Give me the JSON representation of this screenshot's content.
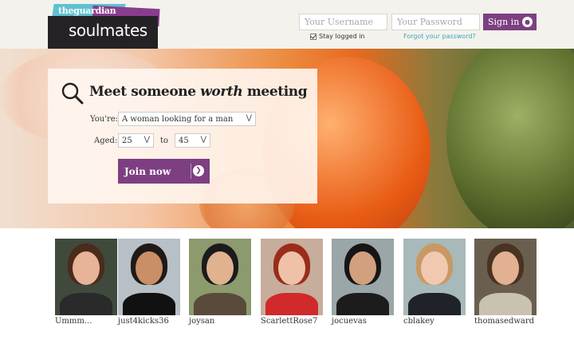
{
  "header": {
    "logo_small": "theguardian",
    "logo_big": "soulmates",
    "username_placeholder": "Your Username",
    "password_placeholder": "Your Password",
    "signin_label": "Sign in",
    "stay_logged_in": "Stay logged in",
    "forgot_password": "Forgot your password?"
  },
  "hero": {
    "title_pre": "Meet someone ",
    "title_em": "worth",
    "title_post": " meeting",
    "youre_label": "You're:",
    "youre_value": "A woman looking for a man",
    "aged_label": "Aged:",
    "age_min": "25",
    "age_to": "to",
    "age_max": "45",
    "join_label": "Join now"
  },
  "members": [
    {
      "name": "Ummm...",
      "bg": "#3f4a3c",
      "skin": "#e7b49a",
      "hair": "#4a2b1c",
      "top": "#2a2a2a"
    },
    {
      "name": "just4kicks36",
      "bg": "#b7c0c6",
      "skin": "#c98f66",
      "hair": "#1f1a17",
      "top": "#111111"
    },
    {
      "name": "joysan",
      "bg": "#8c9a6e",
      "skin": "#e0b28f",
      "hair": "#1b1b1b",
      "top": "#5a4a3c"
    },
    {
      "name": "ScarlettRose7",
      "bg": "#c7ad9c",
      "skin": "#efc1a8",
      "hair": "#9a2c1c",
      "top": "#d02a2a"
    },
    {
      "name": "jocuevas",
      "bg": "#9aa6a8",
      "skin": "#d2a07e",
      "hair": "#161616",
      "top": "#1c1c1c"
    },
    {
      "name": "cblakey",
      "bg": "#a7b9b8",
      "skin": "#f0c9b0",
      "hair": "#c99864",
      "top": "#1f2329"
    },
    {
      "name": "thomasedward",
      "bg": "#6a5f4f",
      "skin": "#e2b192",
      "hair": "#4a3322",
      "top": "#c9c2b1"
    }
  ]
}
